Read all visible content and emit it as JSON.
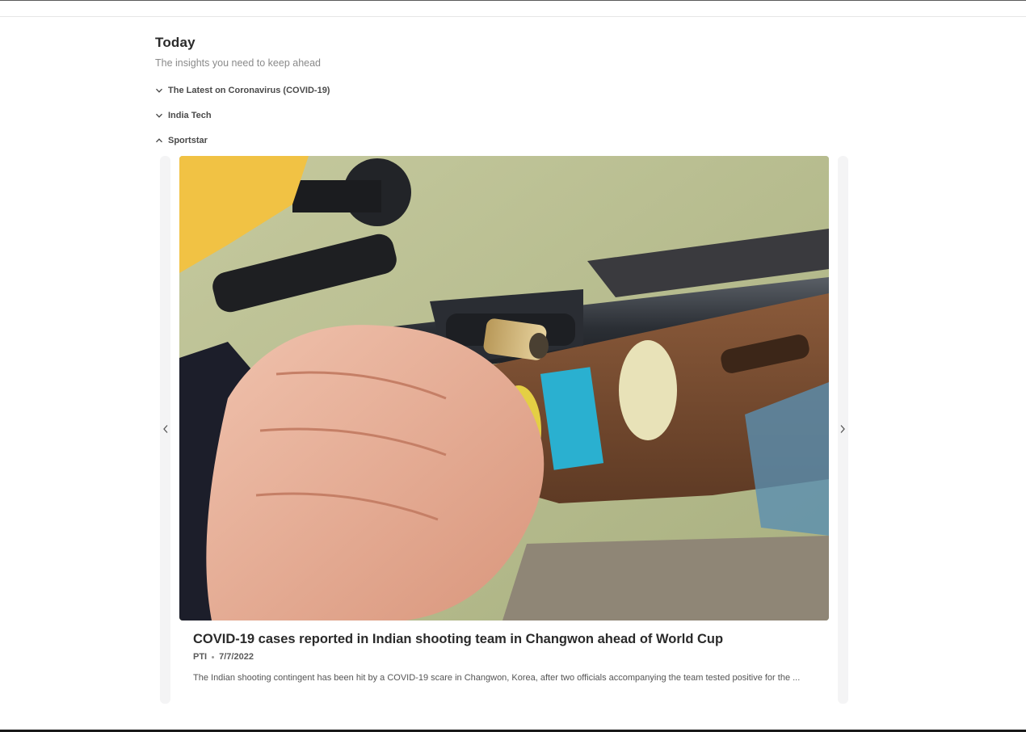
{
  "header": {
    "title": "Today",
    "subtitle": "The insights you need to keep ahead"
  },
  "sections": [
    {
      "label": "The Latest on Coronavirus (COVID-19)",
      "expanded": false,
      "icon": "chevron-down-icon"
    },
    {
      "label": "India Tech",
      "expanded": false,
      "icon": "chevron-down-icon"
    },
    {
      "label": "Sportstar",
      "expanded": true,
      "icon": "chevron-up-icon"
    }
  ],
  "carousel": {
    "prev_icon": "chevron-left-icon",
    "next_icon": "chevron-right-icon",
    "card": {
      "title": "COVID-19 cases reported in Indian shooting team in Changwon ahead of World Cup",
      "source": "PTI",
      "date": "7/7/2022",
      "summary": "The Indian shooting contingent has been hit by a COVID-19 scare in Changwon, Korea, after two officials accompanying the team tested positive for the ...",
      "image_alt": "close-up of a shooter's hand on a rifle with stickers on the wooden stock"
    }
  },
  "colors": {
    "text_primary": "#2a2a2a",
    "text_muted": "#8a8a8a",
    "strip_bg": "#f4f4f5"
  }
}
